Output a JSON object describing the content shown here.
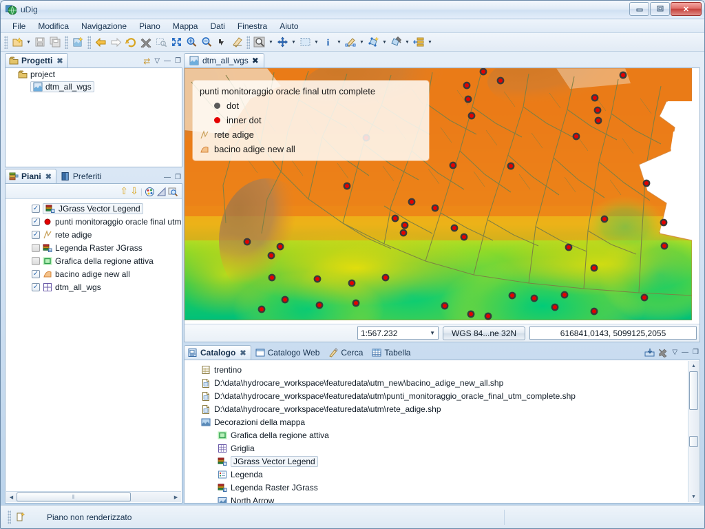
{
  "window": {
    "title": "uDig",
    "app_icon": "globe-icon",
    "minimize_label": "–",
    "maximize_label": "▣",
    "close_label": "✕"
  },
  "menubar": {
    "items": [
      {
        "label": "File"
      },
      {
        "label": "Modifica"
      },
      {
        "label": "Navigazione"
      },
      {
        "label": "Piano"
      },
      {
        "label": "Mappa"
      },
      {
        "label": "Dati"
      },
      {
        "label": "Finestra"
      },
      {
        "label": "Aiuto"
      }
    ]
  },
  "toolbar": {
    "groups": [
      {
        "buttons": [
          {
            "name": "new-project-icon",
            "dropdown": true
          },
          {
            "name": "save-icon",
            "dropdown": false
          },
          {
            "name": "save-all-icon",
            "dropdown": false
          }
        ]
      },
      {
        "buttons": [
          {
            "name": "new-map-icon",
            "dropdown": false
          }
        ]
      },
      {
        "buttons": [
          {
            "name": "back-arrow-icon",
            "dropdown": false
          },
          {
            "name": "forward-arrow-icon",
            "dropdown": false
          },
          {
            "name": "refresh-icon",
            "dropdown": false
          },
          {
            "name": "stop-render-icon",
            "dropdown": false
          },
          {
            "name": "zoom-selection-icon",
            "dropdown": false
          },
          {
            "name": "zoom-extent-icon",
            "dropdown": false
          },
          {
            "name": "zoom-in-icon",
            "dropdown": false
          },
          {
            "name": "zoom-out-icon",
            "dropdown": false
          },
          {
            "name": "pan-right-icon",
            "dropdown": false
          },
          {
            "name": "eraser-icon",
            "dropdown": false
          }
        ]
      },
      {
        "buttons": [
          {
            "name": "zoom-tool-icon",
            "dropdown": true
          },
          {
            "name": "pan-tool-icon",
            "dropdown": true
          },
          {
            "name": "select-box-tool-icon",
            "dropdown": true
          },
          {
            "name": "info-tool-icon",
            "dropdown": true
          },
          {
            "name": "edit-geometry-tool-icon",
            "dropdown": true
          },
          {
            "name": "create-feature-tool-icon",
            "dropdown": true
          },
          {
            "name": "delete-feature-tool-icon",
            "dropdown": true
          },
          {
            "name": "layer-tool-icon",
            "dropdown": true
          }
        ]
      }
    ]
  },
  "projects_view": {
    "tab_label": "Progetti",
    "tab_icon": "project-icon",
    "close_icon": "close-icon",
    "controls": [
      {
        "name": "link-with-editor-icon",
        "glyph": "⇄"
      },
      {
        "name": "view-menu-icon",
        "glyph": "▽"
      },
      {
        "name": "minimize-icon",
        "glyph": "—"
      },
      {
        "name": "maximize-icon",
        "glyph": "❐"
      }
    ],
    "tree": [
      {
        "label": "project",
        "icon": "project-folder-icon",
        "indent": 0,
        "selected": false
      },
      {
        "label": "dtm_all_wgs",
        "icon": "map-icon",
        "indent": 1,
        "selected": true
      }
    ]
  },
  "layers_view": {
    "tabs": [
      {
        "label": "Piani",
        "icon": "layers-icon",
        "active": true,
        "closable": true
      },
      {
        "label": "Preferiti",
        "icon": "bookmarks-icon",
        "active": false,
        "closable": false
      }
    ],
    "controls": [
      {
        "name": "minimize-icon",
        "glyph": "—"
      },
      {
        "name": "maximize-icon",
        "glyph": "❐"
      }
    ],
    "toolbar": [
      {
        "name": "move-layer-up-icon",
        "glyph": "⇧"
      },
      {
        "name": "move-layer-down-icon",
        "glyph": "⇩"
      },
      {
        "name": "style-editor-icon",
        "glyph": "◐"
      },
      {
        "name": "transparency-icon",
        "glyph": "◢"
      },
      {
        "name": "zoom-to-layer-icon",
        "glyph": "⌕"
      }
    ],
    "layers": [
      {
        "label": "JGrass Vector Legend",
        "checked": true,
        "icon": "vector-legend-icon",
        "selected": true
      },
      {
        "label": "punti monitoraggio oracle final utm",
        "checked": true,
        "icon": "point-layer-icon",
        "selected": false
      },
      {
        "label": "rete adige",
        "checked": true,
        "icon": "line-layer-icon",
        "selected": false
      },
      {
        "label": "Legenda Raster JGrass",
        "checked": false,
        "icon": "raster-legend-icon",
        "selected": false
      },
      {
        "label": "Grafica della regione attiva",
        "checked": false,
        "icon": "active-region-icon",
        "selected": false
      },
      {
        "label": "bacino adige new all",
        "checked": true,
        "icon": "polygon-layer-icon",
        "selected": false
      },
      {
        "label": "dtm_all_wgs",
        "checked": true,
        "icon": "grid-layer-icon",
        "selected": false
      }
    ],
    "hscroll": {
      "left_arrow": "◀",
      "right_arrow": "▶",
      "thumb_grip": "‖"
    }
  },
  "map_editor": {
    "tab_label": "dtm_all_wgs",
    "tab_icon": "map-icon",
    "close_icon": "close-icon",
    "legend": {
      "title": "punti monitoraggio oracle final utm complete",
      "entries": [
        {
          "label": "dot",
          "symbol": "gray-dot",
          "indent": true
        },
        {
          "label": "inner dot",
          "symbol": "red-dot",
          "indent": true
        },
        {
          "label": "rete adige",
          "symbol": "line-symbol",
          "indent": false
        },
        {
          "label": "bacino adige new all",
          "symbol": "polygon-symbol",
          "indent": false
        }
      ]
    },
    "status": {
      "scale": "1:567.232",
      "scale_dropdown_icon": "chevron-down-icon",
      "crs_label": "WGS 84...ne 32N",
      "coordinates": "616841,0143, 5099125,2055"
    },
    "colors": {
      "dem_low": "#00c878",
      "dem_mid_green": "#7bdc32",
      "dem_yellow": "#ffe000",
      "dem_orange": "#f08000",
      "dem_high_brown": "#9b7040",
      "stream_line": "#7d7f45",
      "point_fill": "#e40000",
      "point_ring": "#3a3a3a",
      "background": "#ffffff"
    }
  },
  "catalog_view": {
    "tabs": [
      {
        "label": "Catalogo",
        "icon": "catalog-icon",
        "active": true,
        "closable": true
      },
      {
        "label": "Catalogo Web",
        "icon": "web-catalog-icon",
        "active": false,
        "closable": false
      },
      {
        "label": "Cerca",
        "icon": "search-icon",
        "active": false,
        "closable": false
      },
      {
        "label": "Tabella",
        "icon": "table-icon",
        "active": false,
        "closable": false
      }
    ],
    "controls": [
      {
        "name": "add-to-map-icon",
        "glyph": "⬒"
      },
      {
        "name": "remove-icon",
        "glyph": "✖"
      },
      {
        "name": "view-menu-icon",
        "glyph": "▽"
      },
      {
        "name": "minimize-icon",
        "glyph": "—"
      },
      {
        "name": "maximize-icon",
        "glyph": "❐"
      }
    ],
    "items": [
      {
        "label": "trentino",
        "icon": "database-icon",
        "indent": 0,
        "selected": false
      },
      {
        "label": "D:\\data\\hydrocare_workspace\\featuredata\\utm_new\\bacino_adige_new_all.shp",
        "icon": "shapefile-icon",
        "indent": 0,
        "selected": false
      },
      {
        "label": "D:\\data\\hydrocare_workspace\\featuredata\\utm\\punti_monitoraggio_oracle_final_utm_complete.shp",
        "icon": "shapefile-icon",
        "indent": 0,
        "selected": false
      },
      {
        "label": "D:\\data\\hydrocare_workspace\\featuredata\\utm\\rete_adige.shp",
        "icon": "shapefile-icon",
        "indent": 0,
        "selected": false
      },
      {
        "label": "Decorazioni della mappa",
        "icon": "decorations-icon",
        "indent": 0,
        "selected": false
      },
      {
        "label": "Grafica della regione attiva",
        "icon": "active-region-icon",
        "indent": 1,
        "selected": false
      },
      {
        "label": "Griglia",
        "icon": "grid-icon",
        "indent": 1,
        "selected": false
      },
      {
        "label": "JGrass Vector Legend",
        "icon": "vector-legend-icon",
        "indent": 1,
        "selected": true
      },
      {
        "label": "Legenda",
        "icon": "legend-icon",
        "indent": 1,
        "selected": false
      },
      {
        "label": "Legenda Raster JGrass",
        "icon": "raster-legend-icon",
        "indent": 1,
        "selected": false
      },
      {
        "label": "North Arrow",
        "icon": "north-arrow-icon",
        "indent": 1,
        "selected": false
      }
    ],
    "vscroll": {
      "up_arrow": "▲",
      "down_arrow": "▼"
    }
  },
  "statusbar": {
    "icon": "render-status-icon",
    "message": "Piano non renderizzato"
  }
}
